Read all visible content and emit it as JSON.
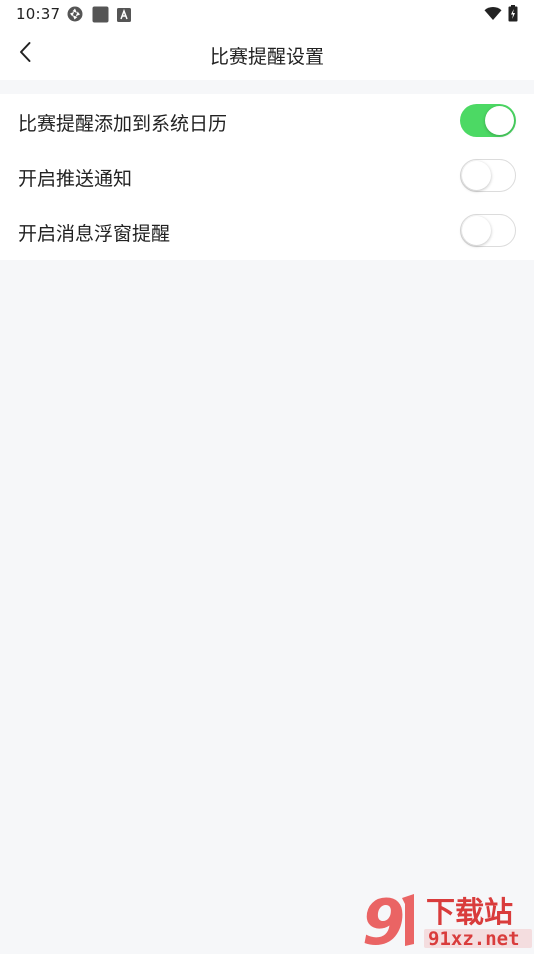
{
  "status_bar": {
    "time": "10:37"
  },
  "header": {
    "title": "比赛提醒设置"
  },
  "settings": [
    {
      "label": "比赛提醒添加到系统日历",
      "enabled": true
    },
    {
      "label": "开启推送通知",
      "enabled": false
    },
    {
      "label": "开启消息浮窗提醒",
      "enabled": false
    }
  ],
  "colors": {
    "toggle_on": "#4cd964",
    "toggle_off_border": "#dcdcdc",
    "background": "#f6f7f9"
  },
  "watermark": {
    "logo_text": "9",
    "brand": "下载站",
    "domain": "91xz.net"
  }
}
